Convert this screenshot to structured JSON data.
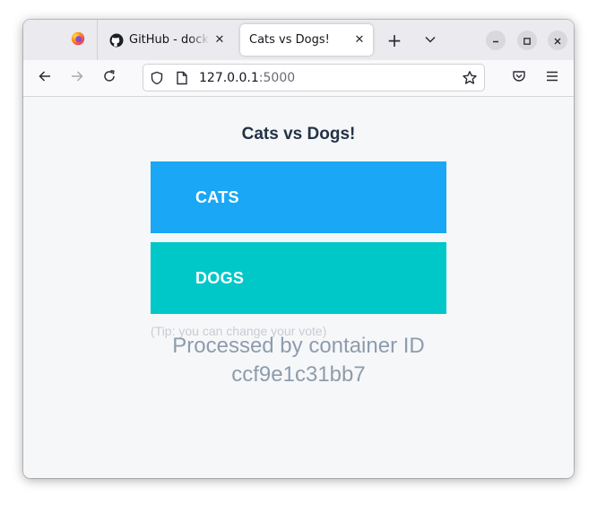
{
  "browser": {
    "tabs": [
      {
        "title": "GitHub - docker/",
        "close_glyph": "✕",
        "icon": "github-icon",
        "active": false
      },
      {
        "title": "Cats vs Dogs!",
        "close_glyph": "✕",
        "active": true
      }
    ],
    "firefox_view_icon": "firefox-icon",
    "new_tab_glyph": "+",
    "url_host": "127.0.0.1",
    "url_port": ":5000"
  },
  "page": {
    "title": "Cats vs Dogs!",
    "options": [
      {
        "label": "CATS",
        "color": "#1aa7f5"
      },
      {
        "label": "DOGS",
        "color": "#00c8c8"
      }
    ],
    "tip": "(Tip: you can change your vote)",
    "processed_line1": "Processed by container ID",
    "processed_line2": "ccf9e1c31bb7"
  },
  "colors": {
    "title_text": "#233246",
    "processed_text": "#8d9cad",
    "tip_text": "#c8cdd2",
    "content_bg": "#f6f7f9"
  }
}
